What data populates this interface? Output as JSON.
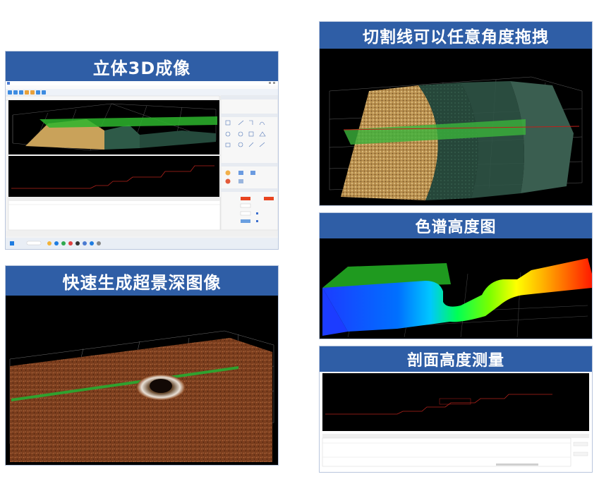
{
  "panels": {
    "p3d": {
      "title": "立体3D成像"
    },
    "deep": {
      "title": "快速生成超景深图像"
    },
    "cut": {
      "title": "切割线可以任意角度拖拽"
    },
    "color": {
      "title": "色谱高度图"
    },
    "profile": {
      "title": "剖面高度测量"
    }
  },
  "colors": {
    "banner": "#2f5ea6",
    "section_green": "#3bb33b",
    "profile_red": "#c0201a"
  },
  "icons": [
    "app-icon",
    "toolbar-icon",
    "drawing-tool-icon",
    "taskbar-icon",
    "windows-start-icon"
  ]
}
